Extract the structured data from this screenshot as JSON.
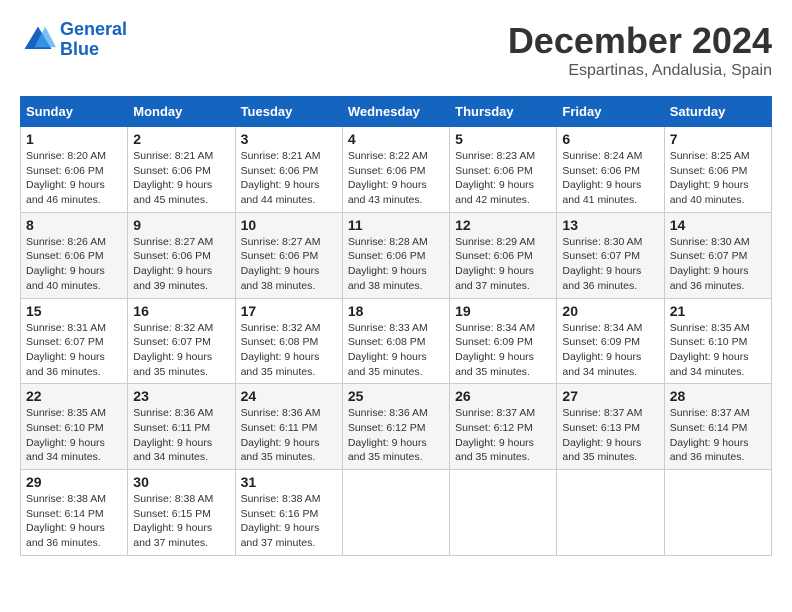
{
  "header": {
    "logo_line1": "General",
    "logo_line2": "Blue",
    "month": "December 2024",
    "location": "Espartinas, Andalusia, Spain"
  },
  "weekdays": [
    "Sunday",
    "Monday",
    "Tuesday",
    "Wednesday",
    "Thursday",
    "Friday",
    "Saturday"
  ],
  "weeks": [
    [
      {
        "day": "1",
        "sunrise": "8:20 AM",
        "sunset": "6:06 PM",
        "daylight": "9 hours and 46 minutes."
      },
      {
        "day": "2",
        "sunrise": "8:21 AM",
        "sunset": "6:06 PM",
        "daylight": "9 hours and 45 minutes."
      },
      {
        "day": "3",
        "sunrise": "8:21 AM",
        "sunset": "6:06 PM",
        "daylight": "9 hours and 44 minutes."
      },
      {
        "day": "4",
        "sunrise": "8:22 AM",
        "sunset": "6:06 PM",
        "daylight": "9 hours and 43 minutes."
      },
      {
        "day": "5",
        "sunrise": "8:23 AM",
        "sunset": "6:06 PM",
        "daylight": "9 hours and 42 minutes."
      },
      {
        "day": "6",
        "sunrise": "8:24 AM",
        "sunset": "6:06 PM",
        "daylight": "9 hours and 41 minutes."
      },
      {
        "day": "7",
        "sunrise": "8:25 AM",
        "sunset": "6:06 PM",
        "daylight": "9 hours and 40 minutes."
      }
    ],
    [
      {
        "day": "8",
        "sunrise": "8:26 AM",
        "sunset": "6:06 PM",
        "daylight": "9 hours and 40 minutes."
      },
      {
        "day": "9",
        "sunrise": "8:27 AM",
        "sunset": "6:06 PM",
        "daylight": "9 hours and 39 minutes."
      },
      {
        "day": "10",
        "sunrise": "8:27 AM",
        "sunset": "6:06 PM",
        "daylight": "9 hours and 38 minutes."
      },
      {
        "day": "11",
        "sunrise": "8:28 AM",
        "sunset": "6:06 PM",
        "daylight": "9 hours and 38 minutes."
      },
      {
        "day": "12",
        "sunrise": "8:29 AM",
        "sunset": "6:06 PM",
        "daylight": "9 hours and 37 minutes."
      },
      {
        "day": "13",
        "sunrise": "8:30 AM",
        "sunset": "6:07 PM",
        "daylight": "9 hours and 36 minutes."
      },
      {
        "day": "14",
        "sunrise": "8:30 AM",
        "sunset": "6:07 PM",
        "daylight": "9 hours and 36 minutes."
      }
    ],
    [
      {
        "day": "15",
        "sunrise": "8:31 AM",
        "sunset": "6:07 PM",
        "daylight": "9 hours and 36 minutes."
      },
      {
        "day": "16",
        "sunrise": "8:32 AM",
        "sunset": "6:07 PM",
        "daylight": "9 hours and 35 minutes."
      },
      {
        "day": "17",
        "sunrise": "8:32 AM",
        "sunset": "6:08 PM",
        "daylight": "9 hours and 35 minutes."
      },
      {
        "day": "18",
        "sunrise": "8:33 AM",
        "sunset": "6:08 PM",
        "daylight": "9 hours and 35 minutes."
      },
      {
        "day": "19",
        "sunrise": "8:34 AM",
        "sunset": "6:09 PM",
        "daylight": "9 hours and 35 minutes."
      },
      {
        "day": "20",
        "sunrise": "8:34 AM",
        "sunset": "6:09 PM",
        "daylight": "9 hours and 34 minutes."
      },
      {
        "day": "21",
        "sunrise": "8:35 AM",
        "sunset": "6:10 PM",
        "daylight": "9 hours and 34 minutes."
      }
    ],
    [
      {
        "day": "22",
        "sunrise": "8:35 AM",
        "sunset": "6:10 PM",
        "daylight": "9 hours and 34 minutes."
      },
      {
        "day": "23",
        "sunrise": "8:36 AM",
        "sunset": "6:11 PM",
        "daylight": "9 hours and 34 minutes."
      },
      {
        "day": "24",
        "sunrise": "8:36 AM",
        "sunset": "6:11 PM",
        "daylight": "9 hours and 35 minutes."
      },
      {
        "day": "25",
        "sunrise": "8:36 AM",
        "sunset": "6:12 PM",
        "daylight": "9 hours and 35 minutes."
      },
      {
        "day": "26",
        "sunrise": "8:37 AM",
        "sunset": "6:12 PM",
        "daylight": "9 hours and 35 minutes."
      },
      {
        "day": "27",
        "sunrise": "8:37 AM",
        "sunset": "6:13 PM",
        "daylight": "9 hours and 35 minutes."
      },
      {
        "day": "28",
        "sunrise": "8:37 AM",
        "sunset": "6:14 PM",
        "daylight": "9 hours and 36 minutes."
      }
    ],
    [
      {
        "day": "29",
        "sunrise": "8:38 AM",
        "sunset": "6:14 PM",
        "daylight": "9 hours and 36 minutes."
      },
      {
        "day": "30",
        "sunrise": "8:38 AM",
        "sunset": "6:15 PM",
        "daylight": "9 hours and 37 minutes."
      },
      {
        "day": "31",
        "sunrise": "8:38 AM",
        "sunset": "6:16 PM",
        "daylight": "9 hours and 37 minutes."
      },
      null,
      null,
      null,
      null
    ]
  ]
}
